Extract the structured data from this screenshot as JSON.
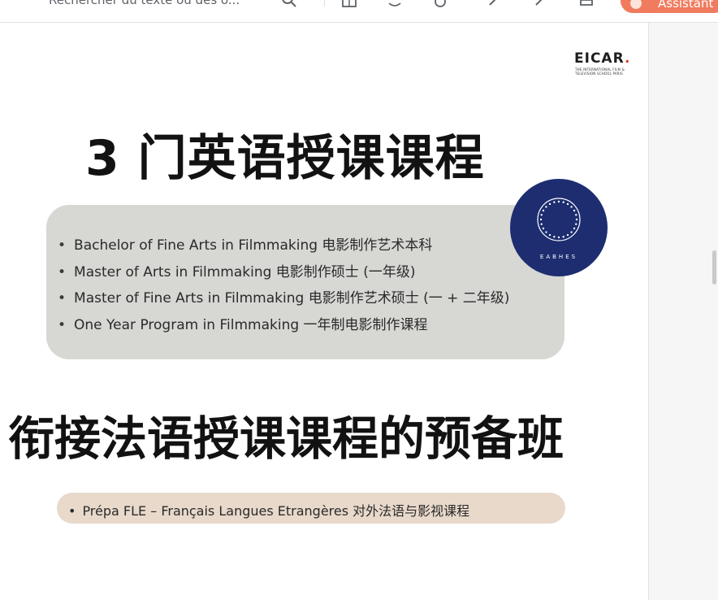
{
  "toolbar": {
    "search_text": "Rechercher du texte ou des o...",
    "assistant_label": "Assistant"
  },
  "logo": {
    "name": "EICAR",
    "dot": ".",
    "subtitle": "The International Film & Television School Paris"
  },
  "seal": {
    "label": "EABHES"
  },
  "section1": {
    "title": "3 门英语授课课程",
    "items": [
      "Bachelor of Fine Arts in Filmmaking 电影制作艺术本科",
      "Master of Arts in Filmmaking 电影制作硕士 (一年级)",
      "Master of Fine Arts in Filmmaking 电影制作艺术硕士 (一 + 二年级)",
      "One Year Program in Filmmaking 一年制电影制作课程"
    ]
  },
  "section2": {
    "title": "衔接法语授课课程的预备班",
    "items": [
      "Prépa FLE – Français Langues Etrangères 对外法语与影视课程"
    ]
  },
  "colors": {
    "box1_bg": "#d7d7d4",
    "box2_bg": "#e8d9cb",
    "seal_bg": "#1d2d70",
    "assistant_bg": "#f07b5e",
    "logo_dot": "#d6452b"
  }
}
